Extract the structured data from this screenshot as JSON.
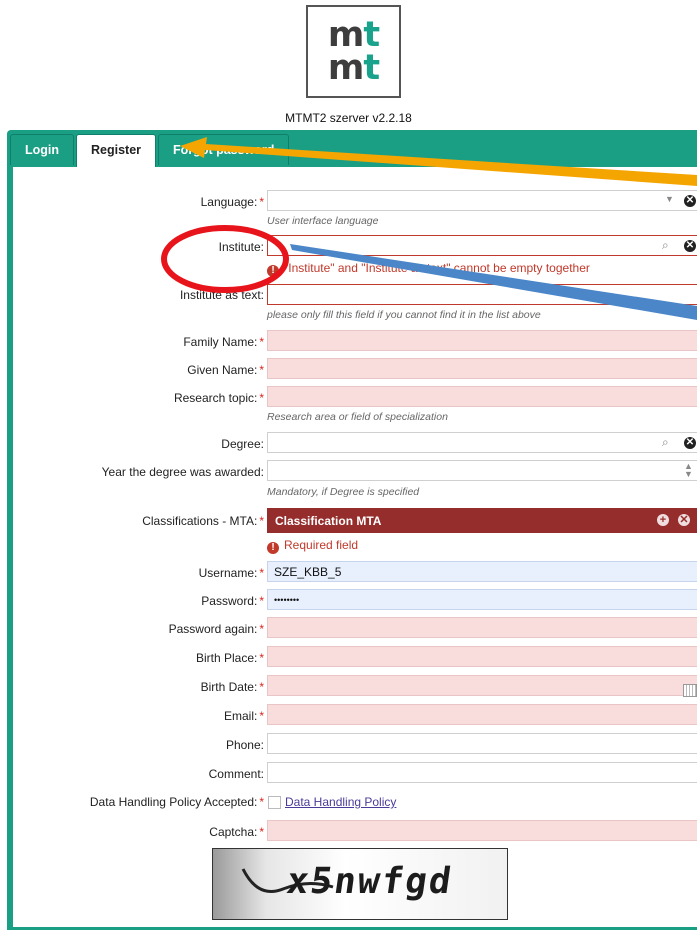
{
  "logo": {
    "line1": "mt",
    "line2": "mt"
  },
  "server_version": "MTMT2 szerver v2.2.18",
  "tabs": [
    {
      "label": "Login"
    },
    {
      "label": "Register"
    },
    {
      "label": "Forgot password"
    }
  ],
  "form": {
    "language": {
      "label": "Language:",
      "hint": "User interface language"
    },
    "institute": {
      "label": "Institute:",
      "error": "\"Institute\" and \"Institute as text\" cannot be empty together"
    },
    "institute_text": {
      "label": "Institute as text:",
      "hint": "please only fill this field if you cannot find it in the list above"
    },
    "family_name": {
      "label": "Family Name:"
    },
    "given_name": {
      "label": "Given Name:"
    },
    "research_topic": {
      "label": "Research topic:",
      "hint": "Research area or field of specialization"
    },
    "degree": {
      "label": "Degree:"
    },
    "degree_year": {
      "label": "Year the degree was awarded:",
      "hint": "Mandatory, if Degree is specified"
    },
    "classifications": {
      "label": "Classifications - MTA:",
      "value": "Classification MTA",
      "error": "Required field"
    },
    "username": {
      "label": "Username:",
      "value": "SZE_KBB_5"
    },
    "password": {
      "label": "Password:",
      "value": "••••••••"
    },
    "password_again": {
      "label": "Password again:"
    },
    "birth_place": {
      "label": "Birth Place:"
    },
    "birth_date": {
      "label": "Birth Date:"
    },
    "email": {
      "label": "Email:"
    },
    "phone": {
      "label": "Phone:"
    },
    "comment": {
      "label": "Comment:"
    },
    "policy": {
      "label": "Data Handling Policy Accepted:",
      "link": "Data Handling Policy"
    },
    "captcha": {
      "label": "Captcha:",
      "image_text": "x5nwfgd"
    }
  },
  "required_mark": "*",
  "icons": {
    "search": "search-icon",
    "clear": "clear-icon",
    "calendar": "calendar-icon",
    "spinner": "spinner-icon",
    "add": "add-icon",
    "dropdown": "dropdown-icon"
  },
  "colors": {
    "teal": "#1a9f85",
    "error": "#c0392b",
    "required_bg": "#f9dcdc",
    "classification_bg": "#962d2d",
    "annotation_orange": "#f5a500",
    "annotation_blue": "#4a86c8",
    "annotation_red": "#e8141b"
  }
}
